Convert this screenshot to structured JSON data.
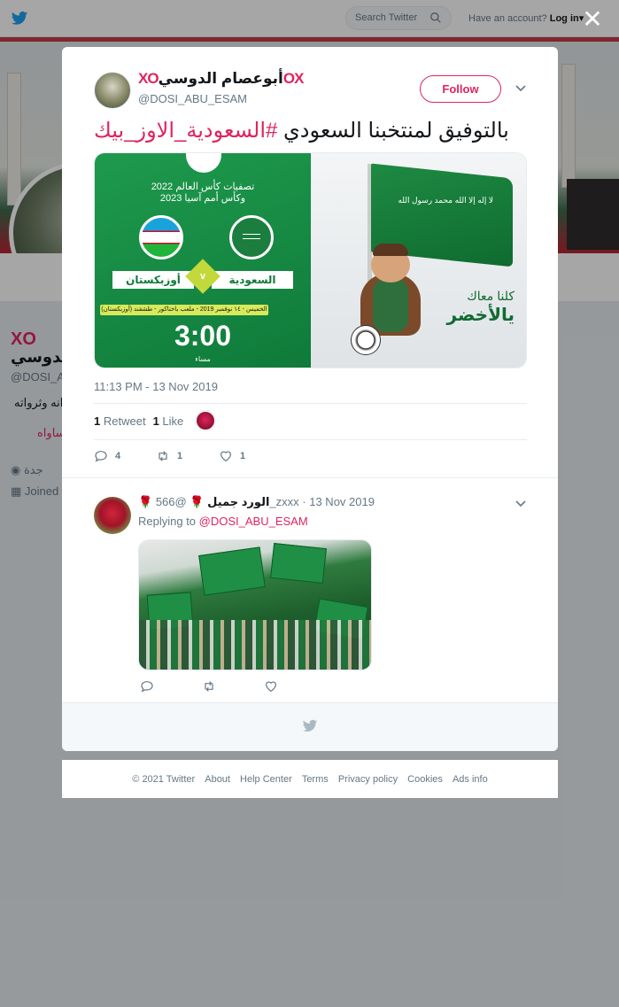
{
  "topbar": {
    "search_placeholder": "Search Twitter",
    "account_prompt": "Have an account?",
    "login_label": "Log in"
  },
  "profile_bg": {
    "name_fragment": "الدوسي",
    "handle_fragment": "@DOSI_A",
    "bio_fragment": "انه وثرواته",
    "bio_link_fragment": "ساواه",
    "location": "جدة",
    "joined_fragment": "Joined"
  },
  "tweet": {
    "author_name": "أبوعصام الدوسي",
    "author_prefix": "XO",
    "author_suffix": "OX",
    "author_handle": "@DOSI_ABU_ESAM",
    "follow_label": "Follow",
    "text": "بالتوفيق لمنتخبنا السعودي",
    "hashtag": "#السعودية_الاوز_بيك",
    "timestamp": "11:13 PM - 13 Nov 2019",
    "retweets_count": "1",
    "retweets_label": "Retweet",
    "likes_count": "1",
    "likes_label": "Like",
    "actions": {
      "replies": "4",
      "retweets": "1",
      "likes": "1"
    },
    "media": {
      "title_line1": "تصفيات كأس العالم 2022",
      "title_line2": "وكأس أمم آسيا 2023",
      "team_home": "السعودية",
      "team_away": "أوزبكستان",
      "vs": "v",
      "match_date": "الخميس - ١٤ نوفمبر 2019 - ملعب باختاكور - طشقند (أوزبكستان)",
      "match_time": "3:00",
      "time_period": "مساء",
      "flag_text": "لا إله إلا الله محمد رسول الله",
      "slogan_line1": "كلنا معاك",
      "slogan_line2": "يالأخضر"
    }
  },
  "reply": {
    "author_name": "الورد جميل",
    "author_handle": "@566_zxxx",
    "date": "13 Nov 2019",
    "replying_to_label": "Replying to",
    "replying_to_handle": "@DOSI_ABU_ESAM"
  },
  "footer": {
    "links": [
      "© 2021 Twitter",
      "About",
      "Help Center",
      "Terms",
      "Privacy policy",
      "Cookies",
      "Ads info"
    ]
  },
  "colors": {
    "accent": "#e0245e",
    "muted": "#657786",
    "text": "#14171a",
    "twitter_blue": "#1da1f2"
  }
}
